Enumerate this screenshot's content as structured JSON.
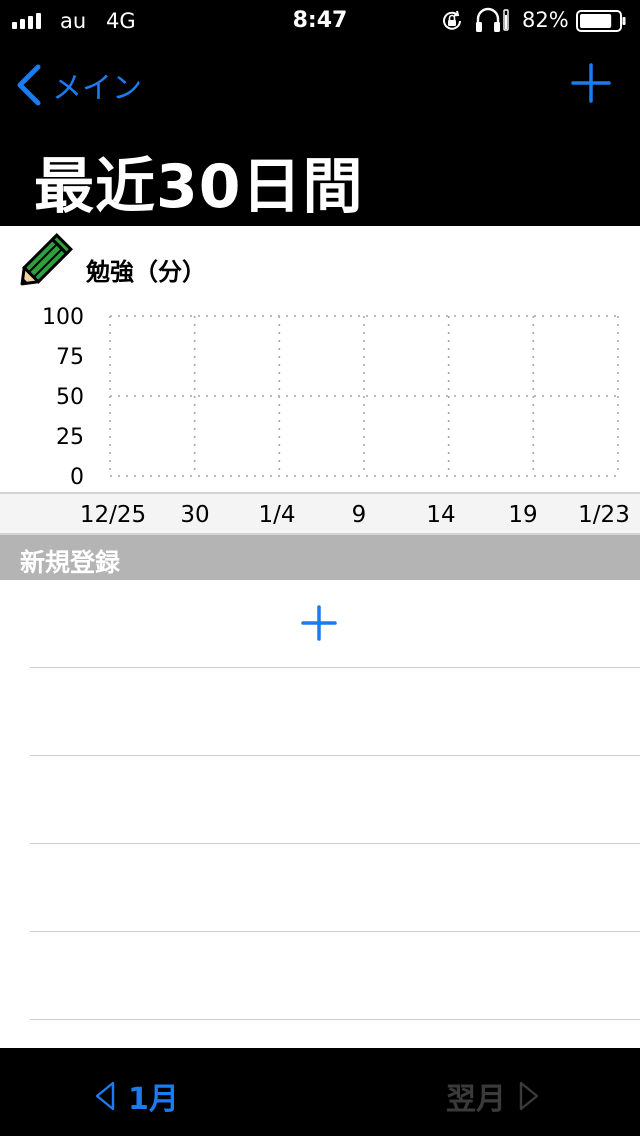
{
  "status_bar": {
    "carrier": "au",
    "network": "4G",
    "time": "8:47",
    "battery_percent": "82%",
    "battery_level": 0.82,
    "icons": [
      "signal-icon",
      "orientation-lock-icon",
      "headphone-icon",
      "battery-icon"
    ]
  },
  "nav": {
    "back_label": "メイン",
    "add_icon": "plus-icon",
    "title": "最近30日間"
  },
  "chart": {
    "icon": "pencil-icon",
    "title": "勉強（分）"
  },
  "chart_data": {
    "type": "line",
    "title": "勉強（分）",
    "xlabel": "",
    "ylabel": "",
    "y_ticks": [
      "100",
      "75",
      "50",
      "25",
      "0"
    ],
    "ylim": [
      0,
      100
    ],
    "x_ticks": [
      "12/25",
      "30",
      "1/4",
      "9",
      "14",
      "19",
      "1/23"
    ],
    "grid": true,
    "series": []
  },
  "section": {
    "header": "新規登録"
  },
  "toolbar": {
    "prev_label": "1月",
    "next_label": "翌月"
  },
  "colors": {
    "accent": "#1a7cf0",
    "bar_background": "#000000",
    "section_header": "#b4b4b4",
    "disabled": "#3a3a3a"
  }
}
